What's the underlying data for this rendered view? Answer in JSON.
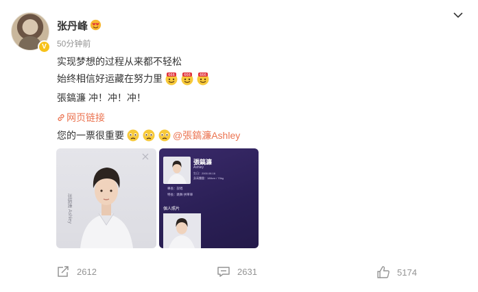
{
  "post": {
    "username": "张丹峰",
    "timestamp": "50分钟前",
    "lines": {
      "line1": "实现梦想的过程从来都不轻松",
      "line2": "始终相信好运藏在努力里",
      "line3": "張鎬濂 冲！冲！冲！",
      "link_icon": "⊘",
      "link_text": "网页链接",
      "line5": "您的一票很重要",
      "mention": "@張鎬濂Ashley"
    },
    "photos": {
      "photo1": {
        "side_text": "张鎬濂 Ashley"
      },
      "photo2": {
        "name": "張鎬濂",
        "en_name": "Ashley",
        "birthday": "生日：2000.08.16",
        "measure": "身高體重：188cm / 70kg",
        "line_a": "專長：說唱",
        "line_b": "特長：跳舞 拼單車",
        "section": "個人照片"
      }
    },
    "stats": {
      "reposts": "2612",
      "comments": "2631",
      "likes": "5174"
    },
    "icons": {
      "verified": "verified-v-badge",
      "name_emoji": "heart-eyes-emoji",
      "more": "chevron-down-icon",
      "link": "link-icon",
      "line2_emoji": "666-emoji",
      "line5_emoji": "pleading-face-emoji",
      "repost": "repost-icon",
      "comment": "comment-icon",
      "like": "thumbs-up-icon"
    },
    "colors": {
      "link": "#eb7350",
      "muted": "#939393",
      "text": "#333333",
      "badge": "#f7c21a"
    }
  }
}
